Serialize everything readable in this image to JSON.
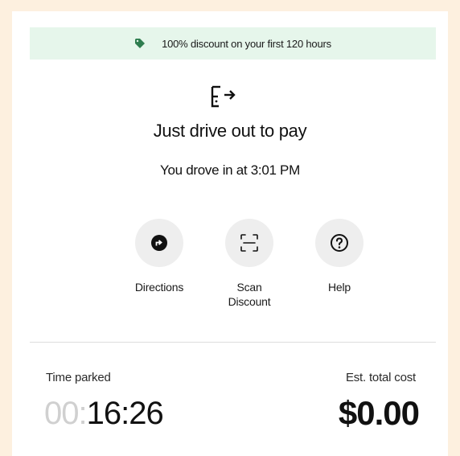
{
  "banner": {
    "icon": "tag-icon",
    "text": "100% discount on your first 120 hours",
    "icon_color": "#2e7d4f"
  },
  "status": {
    "icon": "drive-out-icon",
    "headline": "Just drive out to pay",
    "subline": "You drove in at 3:01 PM"
  },
  "actions": [
    {
      "label": "Directions",
      "icon": "directions-icon"
    },
    {
      "label": "Scan\nDiscount",
      "icon": "scan-icon"
    },
    {
      "label": "Help",
      "icon": "help-icon"
    }
  ],
  "summary": {
    "time_label": "Time parked",
    "time_dim": "00:",
    "time_value": "16:26",
    "cost_label": "Est. total cost",
    "cost_value": "$0.00"
  }
}
